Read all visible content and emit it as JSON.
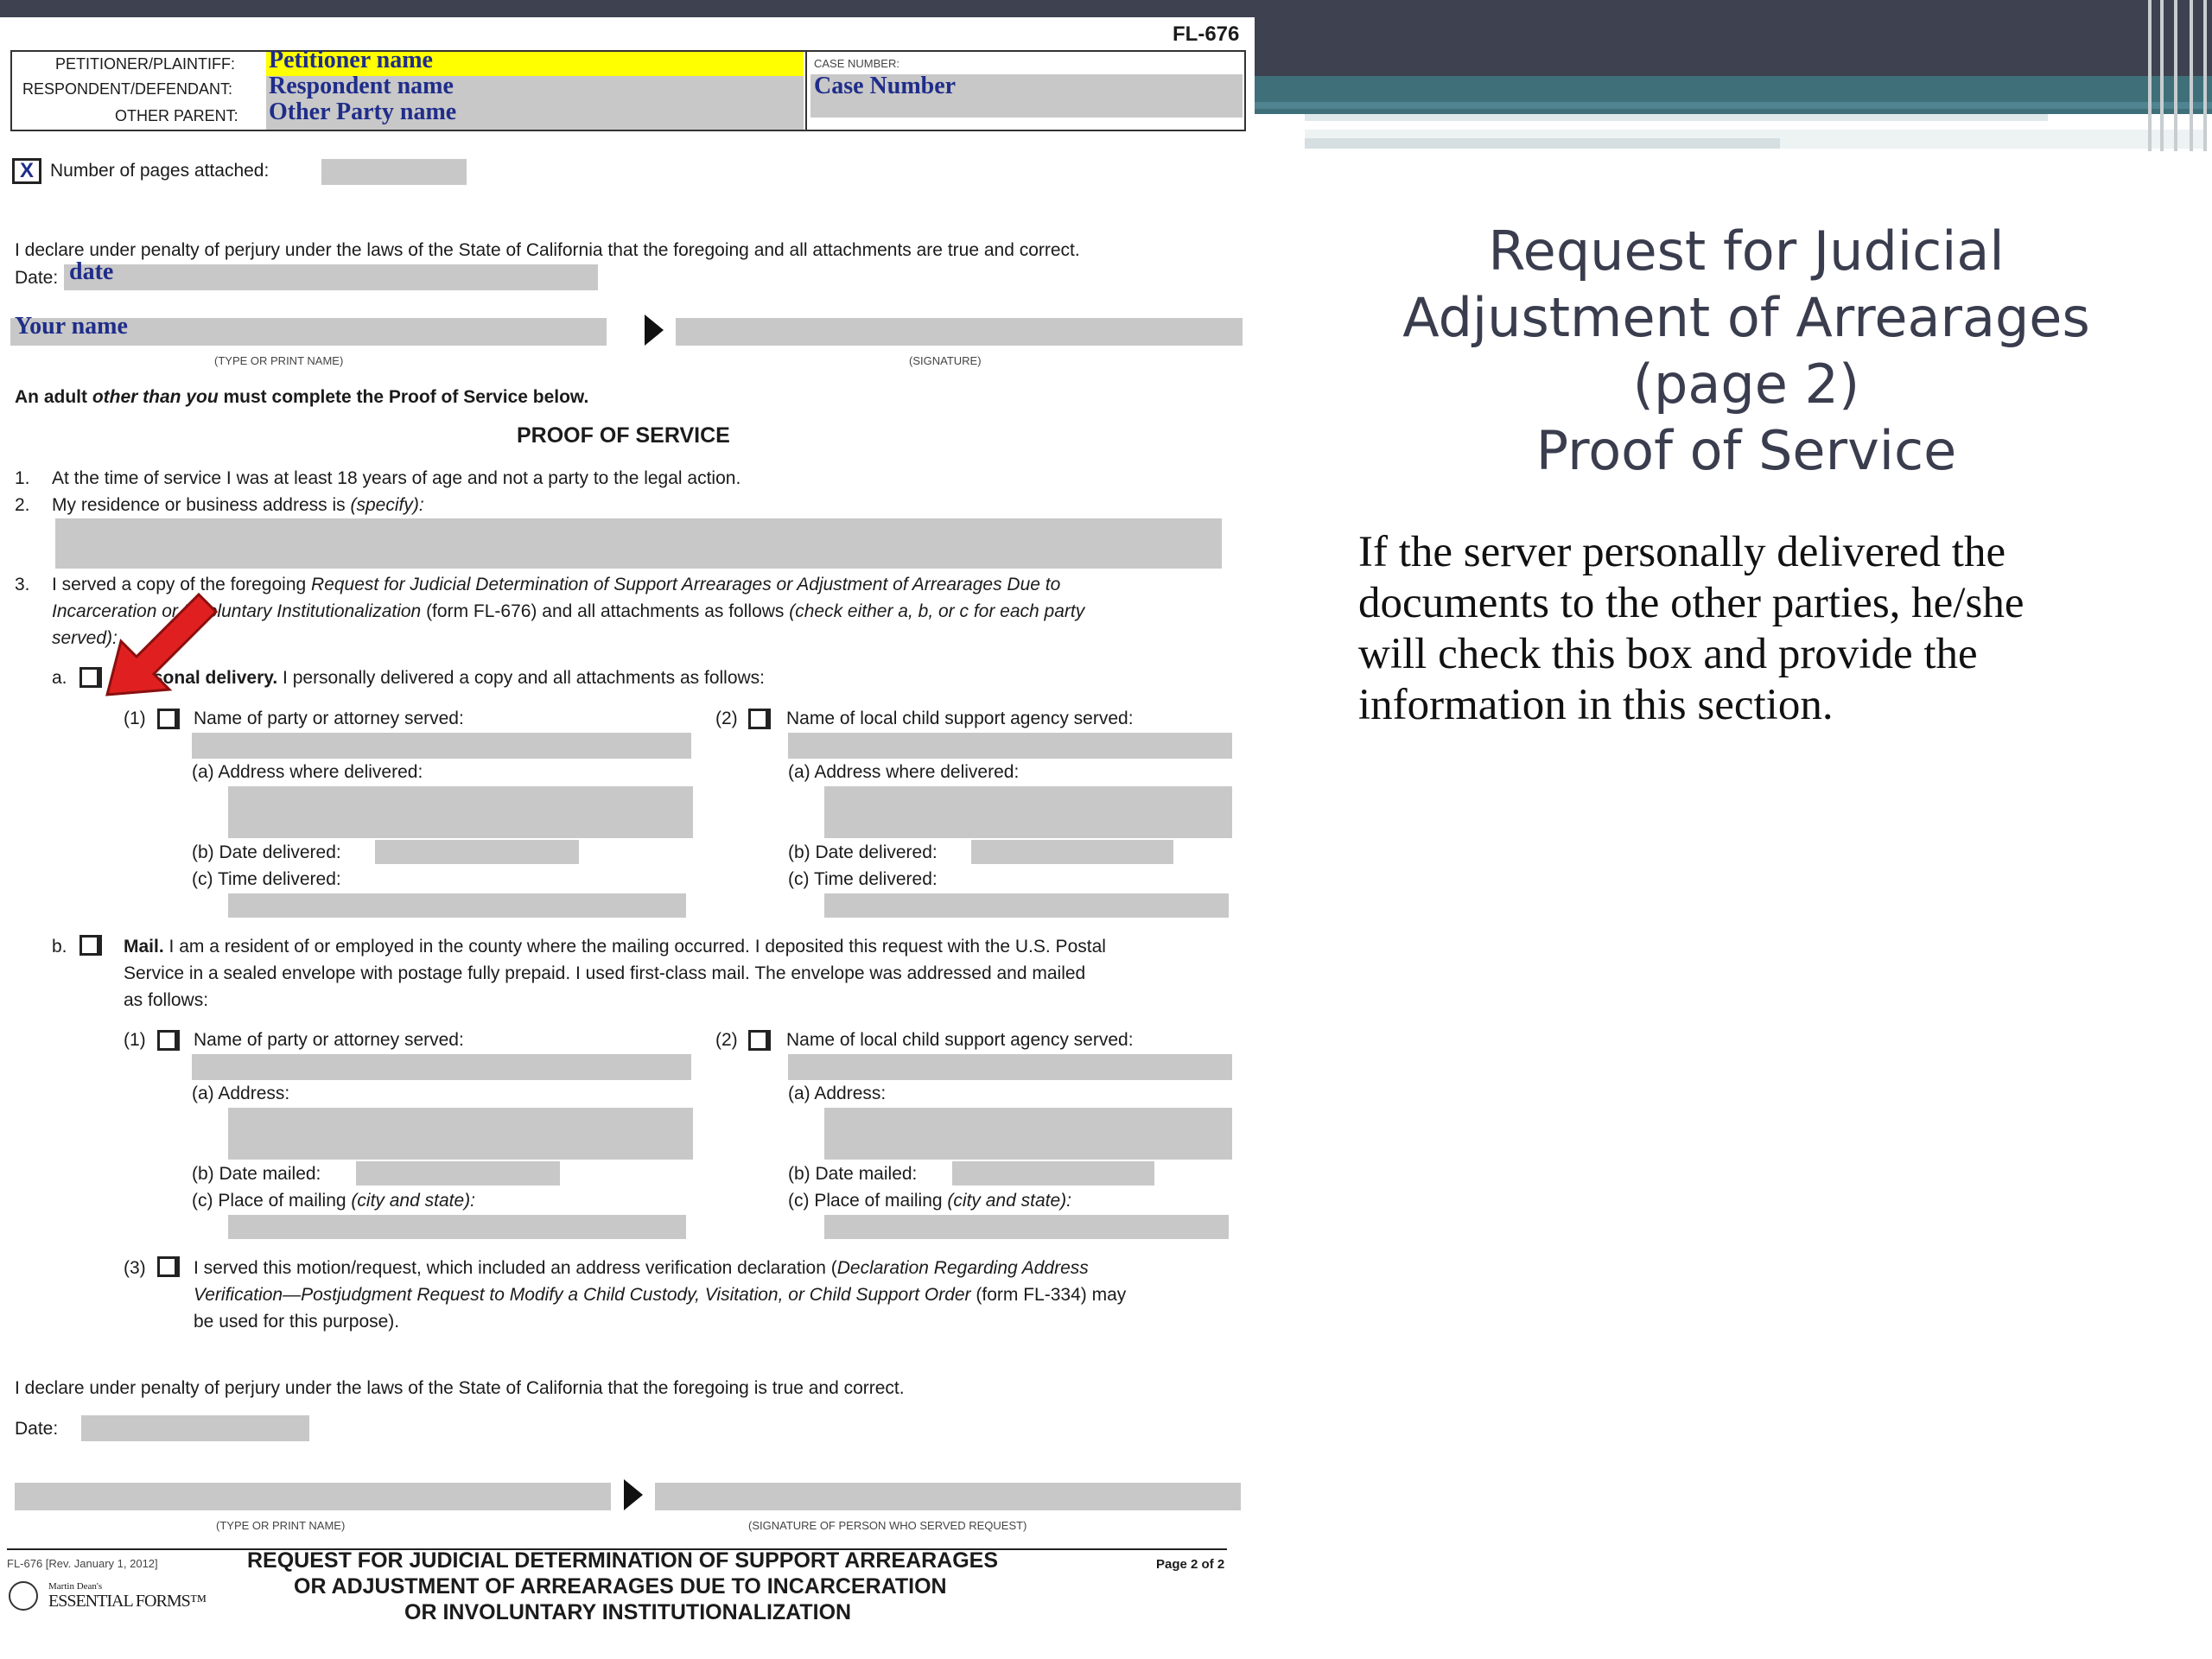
{
  "form": {
    "form_number": "FL-676",
    "caption": {
      "petitioner_label": "PETITIONER/PLAINTIFF:",
      "petitioner_value": "Petitioner name",
      "respondent_label": "RESPONDENT/DEFENDANT:",
      "respondent_value": "Respondent name",
      "other_parent_label": "OTHER PARENT:",
      "other_parent_value": "Other Party name",
      "case_number_label": "CASE NUMBER:",
      "case_number_value": "Case Number"
    },
    "pages_attached_mark": "X",
    "pages_attached_label": "Number of pages attached:",
    "declaration": "I declare under penalty of perjury under the laws of the State of California that the foregoing and all attachments are true and correct.",
    "date_label": "Date:",
    "date_value": "date",
    "name_value": "Your name",
    "type_name_caption": "(TYPE OR PRINT NAME)",
    "signature_caption": "(SIGNATURE)",
    "adult_note_pre": "An adult ",
    "adult_note_em": "other than you",
    "adult_note_post": " must complete the Proof of Service below.",
    "proof_heading": "PROOF OF SERVICE",
    "item1_num": "1.",
    "item1": "At the time of service I was at least 18 years of age and not a party to the legal action.",
    "item2_num": "2.",
    "item2_pre": "My residence or business address is ",
    "item2_em": "(specify):",
    "item3_num": "3.",
    "item3_line1_pre": "I served a copy of the foregoing ",
    "item3_line1_em": "Request for Judicial Determination of Support Arrearages or Adjustment of Arrearages Due to",
    "item3_line2_em1": "Incarceration or Involuntary Institutionalization",
    "item3_line2_mid": " (form FL-676) and all attachments as follows ",
    "item3_line2_em2": "(check either a, b, or c for each party",
    "item3_line3_em": "served):",
    "a_letter": "a.",
    "a_bold": "Personal delivery.",
    "a_rest": " I personally delivered a copy and all attachments as follows:",
    "n1": "(1)",
    "n2": "(2)",
    "n3": "(3)",
    "party_served": "Name of party or attorney served:",
    "agency_served": "Name of local child support agency served:",
    "addr_delivered": "(a)  Address where delivered:",
    "date_delivered": "(b)  Date delivered:",
    "time_delivered": "(c)  Time delivered:",
    "b_letter": "b.",
    "b_bold": "Mail.",
    "b_line1": " I am a resident of or employed in the county where the mailing occurred. I deposited this request with the U.S. Postal",
    "b_line2": "Service in a sealed envelope with postage fully prepaid. I used first-class mail. The envelope was addressed and mailed",
    "b_line3": "as follows:",
    "address": "(a)  Address:",
    "date_mailed": "(b)  Date mailed:",
    "place_mailing_pre": "(c)  Place of mailing ",
    "place_mailing_em": "(city and state):",
    "item_b3_line1_pre": "I served this motion/request, which included an address verification declaration (",
    "item_b3_line1_em": "Declaration Regarding Address",
    "item_b3_line2_em": "Verification—Postjudgment Request to Modify a Child Custody, Visitation, or Child Support Order",
    "item_b3_line2_post": " (form FL-334) may",
    "item_b3_line3": "be used for this purpose).",
    "declaration2": "I declare under penalty of perjury under the laws of the State of California that the foregoing is true and correct.",
    "date_label2": "Date:",
    "type_name_caption2": "(TYPE OR PRINT NAME)",
    "server_signature_caption": "(SIGNATURE OF PERSON WHO SERVED REQUEST)",
    "footer_rev": "FL-676 [Rev. January 1, 2012]",
    "footer_title_1": "REQUEST FOR JUDICIAL DETERMINATION OF SUPPORT ARREARAGES",
    "footer_title_2": "OR ADJUSTMENT OF ARREARAGES DUE TO INCARCERATION",
    "footer_title_3": "OR INVOLUNTARY INSTITUTIONALIZATION",
    "footer_page": "Page 2 of 2",
    "footer_logo_small": "Martin Dean's",
    "footer_logo_big": "ESSENTIAL FORMS™"
  },
  "slide": {
    "title_lines": [
      "Request for Judicial",
      "Adjustment of Arrearages",
      "(page 2)",
      "Proof of Service"
    ],
    "body_lines": [
      "If the server personally delivered the",
      "documents to the other parties, he/she",
      "will check this box and provide the",
      "information in this section."
    ]
  },
  "colors": {
    "header_dark": "#3e4150",
    "header_teal": "#3f7079",
    "highlight": "#ffff00",
    "fill_blue": "#1f2d8a",
    "arrow_red": "#e02020"
  }
}
